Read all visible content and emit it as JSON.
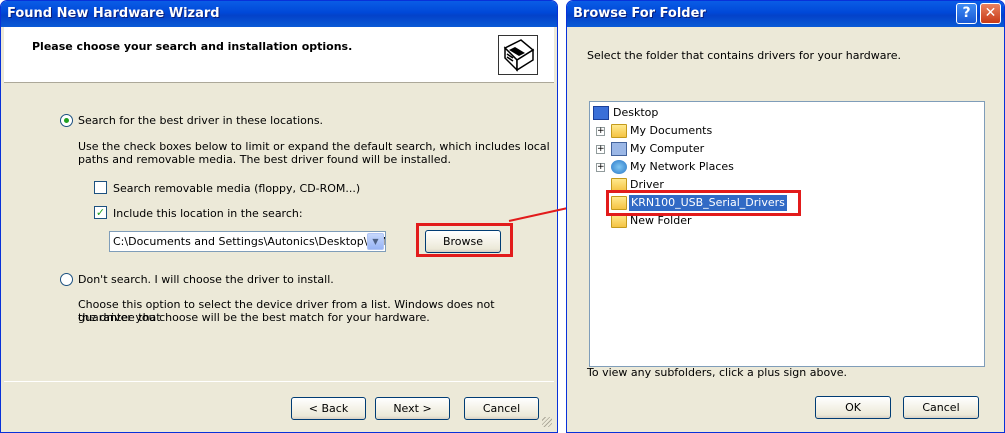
{
  "wizard": {
    "title": "Found New Hardware Wizard",
    "header": "Please choose your search and installation options.",
    "option_search": "Search for the best driver in these locations.",
    "option_search_desc_1": "Use the check boxes below to limit or expand the default search, which includes local",
    "option_search_desc_2": "paths and removable media. The best driver found will be installed.",
    "check_removable": "Search removable media (floppy, CD-ROM...)",
    "check_location": "Include this location in the search:",
    "location_value": "C:\\Documents and Settings\\Autonics\\Desktop\\KRN",
    "browse_label": "Browse",
    "option_dont_search": "Don't search. I will choose the driver to install.",
    "dont_search_desc_1": "Choose this option to select the device driver from a list.  Windows does not guarantee that",
    "dont_search_desc_2": "the driver you choose will be the best match for your hardware.",
    "back_label": "< Back",
    "next_label": "Next >",
    "cancel_label": "Cancel"
  },
  "browse": {
    "title": "Browse For Folder",
    "help_label": "?",
    "close_label": "✕",
    "instruction": "Select the folder that contains drivers for your hardware.",
    "tree": [
      {
        "label": "Desktop"
      },
      {
        "label": "My Documents"
      },
      {
        "label": "My Computer"
      },
      {
        "label": "My Network Places"
      },
      {
        "label": "Driver"
      },
      {
        "label": "KRN100_USB_Serial_Drivers"
      },
      {
        "label": "New Folder"
      }
    ],
    "hint": "To view any subfolders, click a plus sign above.",
    "ok_label": "OK",
    "cancel_label": "Cancel"
  },
  "colors": {
    "highlight": "#e21b1b",
    "selection": "#316ac5"
  }
}
